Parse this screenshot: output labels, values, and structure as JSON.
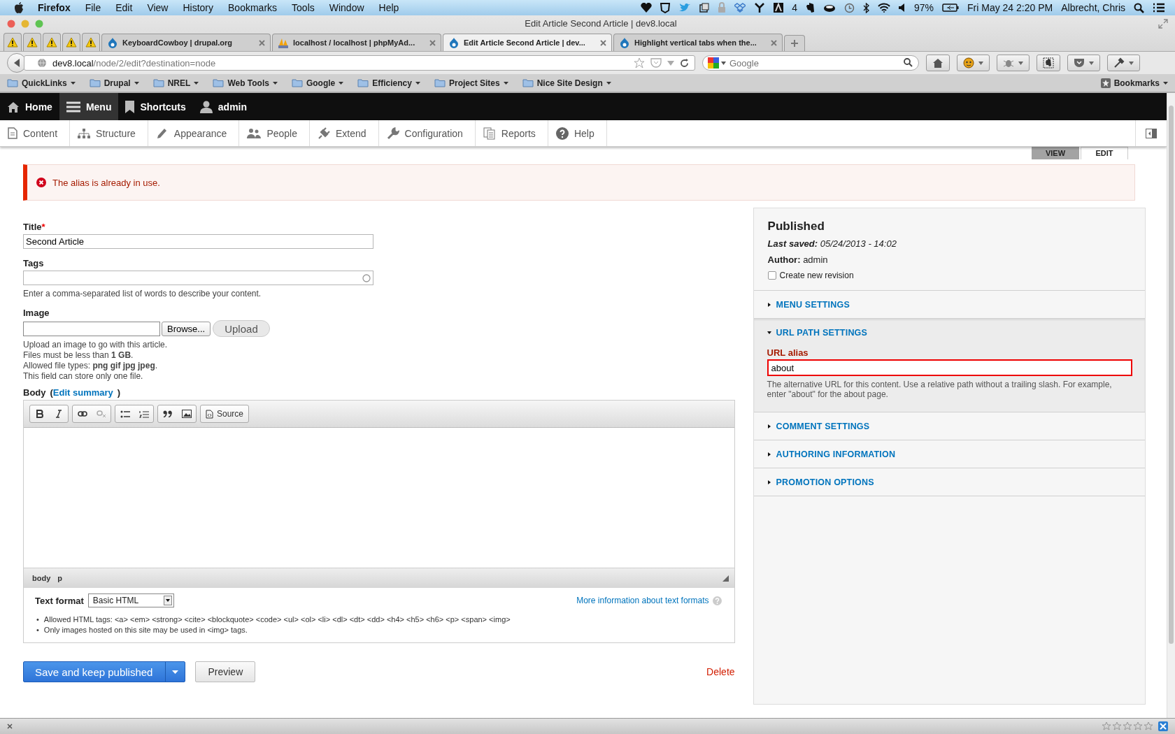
{
  "mac_menubar": {
    "app": "Firefox",
    "menus": [
      "File",
      "Edit",
      "View",
      "History",
      "Bookmarks",
      "Tools",
      "Window",
      "Help"
    ],
    "adobe_count": "4",
    "battery": "97%",
    "clock": "Fri May 24  2:20 PM",
    "user": "Albrecht, Chris"
  },
  "window": {
    "title": "Edit Article Second Article | dev8.local"
  },
  "browser_tabs": [
    {
      "label": "KeyboardCowboy | drupal.org",
      "selected": false,
      "kind": "drop"
    },
    {
      "label": "localhost / localhost | phpMyAd...",
      "selected": false,
      "kind": "pma"
    },
    {
      "label": "Edit Article Second Article | dev...",
      "selected": true,
      "kind": "drop"
    },
    {
      "label": "Highlight vertical tabs when the...",
      "selected": false,
      "kind": "drop"
    }
  ],
  "address_bar": {
    "host": "dev8.local",
    "path": "/node/2/edit?destination=node"
  },
  "search": {
    "placeholder": "Google"
  },
  "bookmarks": [
    "QuickLinks",
    "Drupal",
    "NREL",
    "Web Tools",
    "Google",
    "Efficiency",
    "Project Sites",
    "Nice Site Design"
  ],
  "bookmarks_menu": "Bookmarks",
  "admin_toolbar": [
    {
      "label": "Home",
      "selected": false
    },
    {
      "label": "Menu",
      "selected": true
    },
    {
      "label": "Shortcuts",
      "selected": false
    },
    {
      "label": "admin",
      "selected": false
    }
  ],
  "admin_menu": [
    "Content",
    "Structure",
    "Appearance",
    "People",
    "Extend",
    "Configuration",
    "Reports",
    "Help"
  ],
  "local_tabs": [
    {
      "label": "VIEW",
      "selected": false
    },
    {
      "label": "EDIT",
      "selected": true
    }
  ],
  "error_message": "The alias is already in use.",
  "form": {
    "title_label": "Title",
    "required_mark": "*",
    "bullet": "•",
    "paren_open": "(",
    "paren_close": ")",
    "title_value": "Second Article",
    "tags_label": "Tags",
    "tags_description": "Enter a comma-separated list of words to describe your content.",
    "image_label": "Image",
    "browse_button": "Browse...",
    "upload_button": "Upload",
    "image_help": [
      "Upload an image to go with this article.",
      "Files must be less than **1 GB**.",
      "Allowed file types: **png gif jpg jpeg**.",
      "This field can store only one file."
    ],
    "body_label": "Body",
    "edit_summary": "Edit summary",
    "source_button": "Source",
    "path": [
      "body",
      "p"
    ],
    "text_format_label": "Text format",
    "text_format_value": "Basic HTML",
    "format_info_link": "More information about text formats",
    "format_tips": [
      "Allowed HTML tags: <a> <em> <strong> <cite> <blockquote> <code> <ul> <ol> <li> <dl> <dt> <dd> <h4> <h5> <h6> <p> <span> <img>",
      "Only images hosted on this site may be used in <img> tags."
    ]
  },
  "actions": {
    "save": "Save and keep published",
    "preview": "Preview",
    "delete": "Delete"
  },
  "sidebar": {
    "status": "Published",
    "last_saved": "**Last saved:** 05/24/2013 - 14:02",
    "author": "**Author:** admin",
    "new_revision": {
      "label": "Create new revision",
      "checked": false
    },
    "sections": [
      {
        "title": "MENU SETTINGS",
        "expanded": false
      },
      {
        "title": "URL PATH SETTINGS",
        "expanded": true,
        "field_label": "URL alias",
        "field_value": "about",
        "error": true,
        "description": "The alternative URL for this content. Use a relative path without a trailing slash. For example, enter \"about\" for the about page."
      },
      {
        "title": "COMMENT SETTINGS",
        "expanded": false
      },
      {
        "title": "AUTHORING INFORMATION",
        "expanded": false
      },
      {
        "title": "PROMOTION OPTIONS",
        "expanded": false
      }
    ]
  }
}
